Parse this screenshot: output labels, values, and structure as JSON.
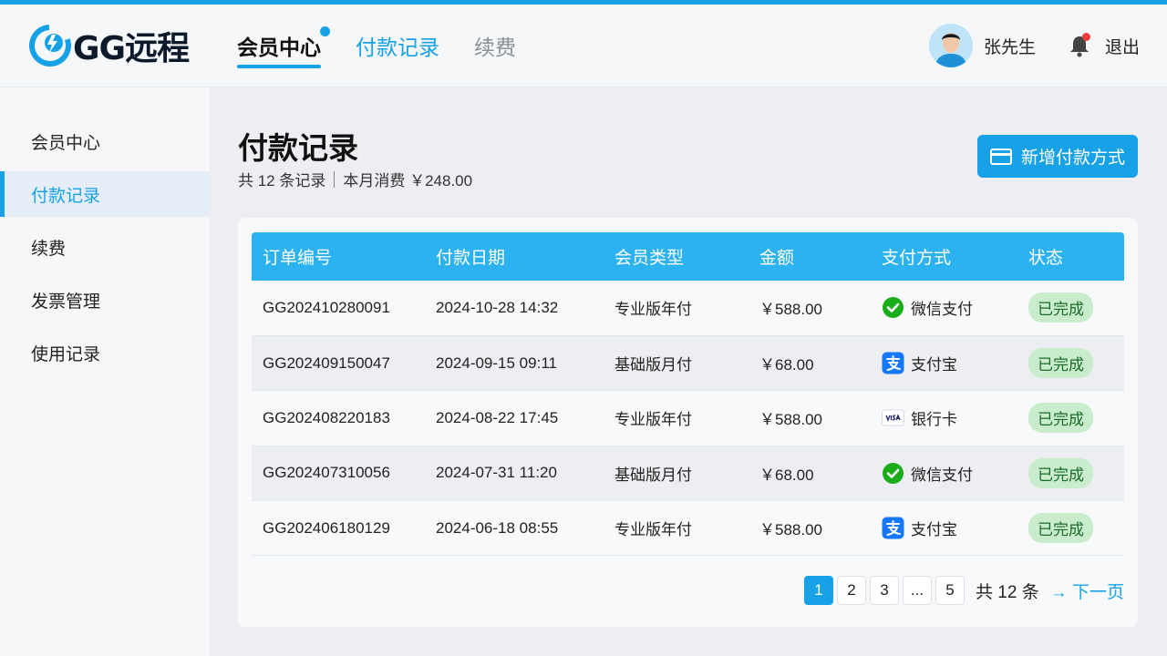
{
  "brand": {
    "name": "GG远程",
    "accent": "#17a2e8"
  },
  "nav": [
    {
      "label": "会员中心"
    },
    {
      "label": "付款记录"
    },
    {
      "label": "续费"
    }
  ],
  "user": {
    "name": "张先生",
    "logout": "退出"
  },
  "sidebar": {
    "items": [
      {
        "label": "会员中心"
      },
      {
        "label": "付款记录"
      },
      {
        "label": "续费"
      },
      {
        "label": "发票管理"
      },
      {
        "label": "使用记录"
      }
    ]
  },
  "page": {
    "title": "付款记录",
    "summary_count": "共 12 条记录",
    "summary_spend": "本月消费 ￥248.00",
    "add_button": "新增付款方式"
  },
  "table": {
    "columns": [
      "订单编号",
      "付款日期",
      "会员类型",
      "金额",
      "支付方式",
      "状态"
    ],
    "rows": [
      {
        "order": "GG202410280091",
        "date": "2024-10-28 14:32",
        "type": "专业版年付",
        "amount": "￥588.00",
        "method": "微信支付",
        "method_icon": "wechat-icon",
        "status": "已完成"
      },
      {
        "order": "GG202409150047",
        "date": "2024-09-15 09:11",
        "type": "基础版月付",
        "amount": "￥68.00",
        "method": "支付宝",
        "method_icon": "alipay-icon",
        "status": "已完成"
      },
      {
        "order": "GG202408220183",
        "date": "2024-08-22 17:45",
        "type": "专业版年付",
        "amount": "￥588.00",
        "method": "银行卡",
        "method_icon": "visa-card-icon",
        "status": "已完成"
      },
      {
        "order": "GG202407310056",
        "date": "2024-07-31 11:20",
        "type": "基础版月付",
        "amount": "￥68.00",
        "method": "微信支付",
        "method_icon": "wechat-icon",
        "status": "已完成"
      },
      {
        "order": "GG202406180129",
        "date": "2024-06-18 08:55",
        "type": "专业版年付",
        "amount": "￥588.00",
        "method": "支付宝",
        "method_icon": "alipay-icon",
        "status": "已完成"
      }
    ]
  },
  "pagination": {
    "pages": [
      "1",
      "2",
      "3",
      "...",
      "5"
    ],
    "current": "1",
    "total": "共 12 条",
    "next": "→ 下一页"
  }
}
